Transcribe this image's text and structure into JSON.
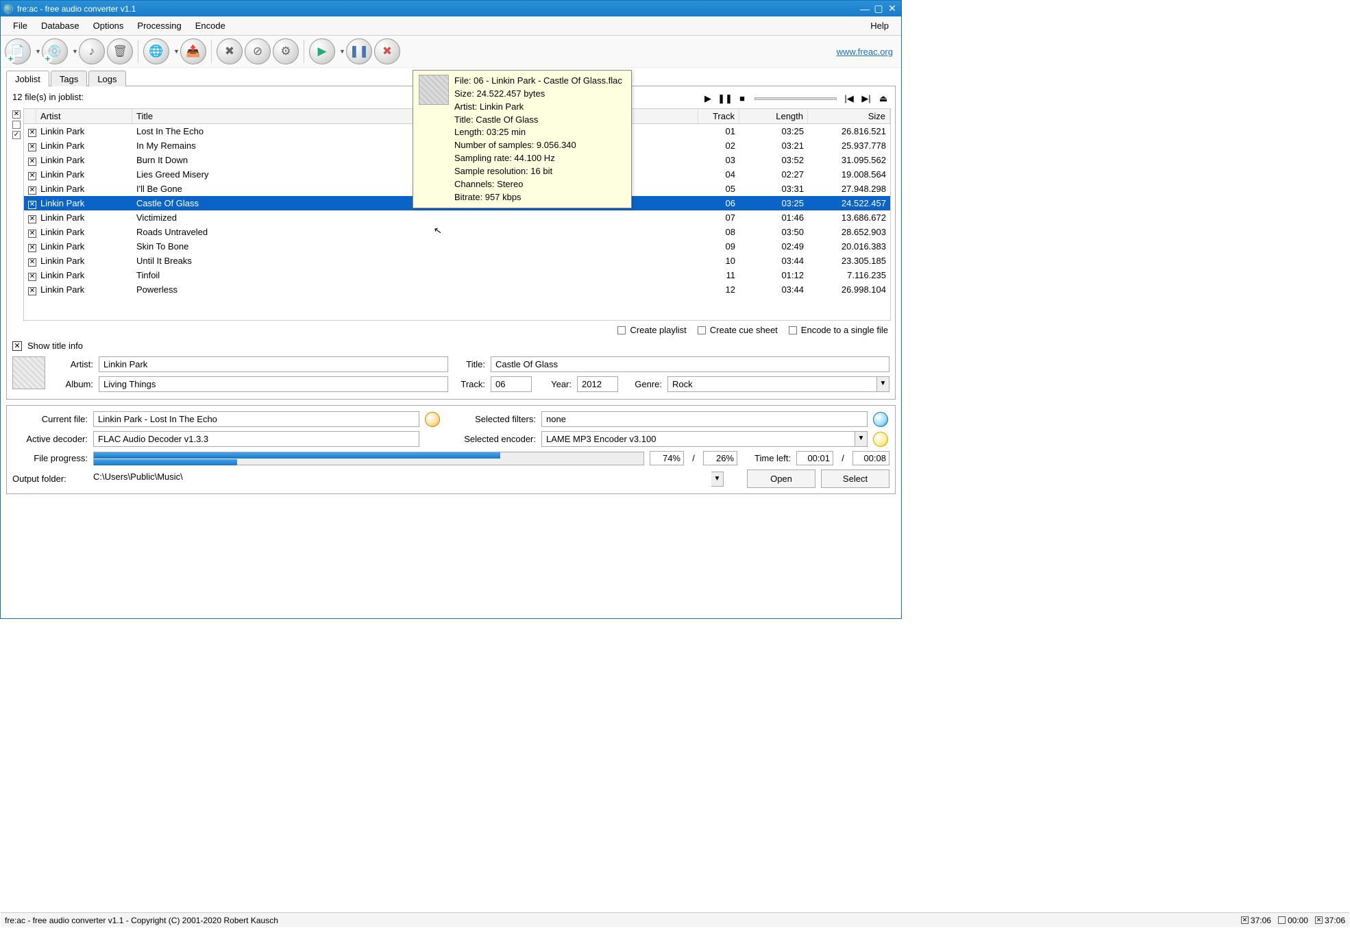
{
  "window": {
    "title": "fre:ac - free audio converter v1.1"
  },
  "menubar": {
    "file": "File",
    "database": "Database",
    "options": "Options",
    "processing": "Processing",
    "encode": "Encode",
    "help": "Help"
  },
  "toolbar": {
    "website": "www.freac.org"
  },
  "tabs": {
    "joblist": "Joblist",
    "tags": "Tags",
    "logs": "Logs"
  },
  "joblist": {
    "count_label": "12 file(s) in joblist:",
    "headers": {
      "artist": "Artist",
      "title": "Title",
      "track": "Track",
      "length": "Length",
      "size": "Size"
    },
    "rows": [
      {
        "artist": "Linkin Park",
        "title": "Lost In The Echo",
        "track": "01",
        "length": "03:25",
        "size": "26.816.521"
      },
      {
        "artist": "Linkin Park",
        "title": "In My Remains",
        "track": "02",
        "length": "03:21",
        "size": "25.937.778"
      },
      {
        "artist": "Linkin Park",
        "title": "Burn It Down",
        "track": "03",
        "length": "03:52",
        "size": "31.095.562"
      },
      {
        "artist": "Linkin Park",
        "title": "Lies Greed Misery",
        "track": "04",
        "length": "02:27",
        "size": "19.008.564"
      },
      {
        "artist": "Linkin Park",
        "title": "I'll Be Gone",
        "track": "05",
        "length": "03:31",
        "size": "27.948.298"
      },
      {
        "artist": "Linkin Park",
        "title": "Castle Of Glass",
        "track": "06",
        "length": "03:25",
        "size": "24.522.457"
      },
      {
        "artist": "Linkin Park",
        "title": "Victimized",
        "track": "07",
        "length": "01:46",
        "size": "13.686.672"
      },
      {
        "artist": "Linkin Park",
        "title": "Roads Untraveled",
        "track": "08",
        "length": "03:50",
        "size": "28.652.903"
      },
      {
        "artist": "Linkin Park",
        "title": "Skin To Bone",
        "track": "09",
        "length": "02:49",
        "size": "20.016.383"
      },
      {
        "artist": "Linkin Park",
        "title": "Until It Breaks",
        "track": "10",
        "length": "03:44",
        "size": "23.305.185"
      },
      {
        "artist": "Linkin Park",
        "title": "Tinfoil",
        "track": "11",
        "length": "01:12",
        "size": "7.116.235"
      },
      {
        "artist": "Linkin Park",
        "title": "Powerless",
        "track": "12",
        "length": "03:44",
        "size": "26.998.104"
      }
    ],
    "selected_index": 5,
    "options": {
      "playlist": "Create playlist",
      "cuesheet": "Create cue sheet",
      "single": "Encode to a single file"
    },
    "show_title": "Show title info"
  },
  "tooltip": {
    "file": "File: 06 - Linkin Park - Castle Of Glass.flac",
    "size": "Size: 24.522.457 bytes",
    "artist": "Artist: Linkin Park",
    "title": "Title: Castle Of Glass",
    "length": "Length: 03:25 min",
    "samples": "Number of samples: 9.056.340",
    "rate": "Sampling rate: 44.100 Hz",
    "res": "Sample resolution: 16 bit",
    "chan": "Channels: Stereo",
    "bitrate": "Bitrate: 957 kbps"
  },
  "meta": {
    "artist_lbl": "Artist:",
    "artist": "Linkin Park",
    "title_lbl": "Title:",
    "title": "Castle Of Glass",
    "album_lbl": "Album:",
    "album": "Living Things",
    "track_lbl": "Track:",
    "track": "06",
    "year_lbl": "Year:",
    "year": "2012",
    "genre_lbl": "Genre:",
    "genre": "Rock"
  },
  "status": {
    "curfile_lbl": "Current file:",
    "curfile": "Linkin Park - Lost In The Echo",
    "decoder_lbl": "Active decoder:",
    "decoder": "FLAC Audio Decoder v1.3.3",
    "filters_lbl": "Selected filters:",
    "filters": "none",
    "encoder_lbl": "Selected encoder:",
    "encoder": "LAME MP3 Encoder v3.100",
    "progress_lbl": "File progress:",
    "pct1": "74%",
    "slash": "/",
    "pct2": "26%",
    "timeleft_lbl": "Time left:",
    "time1": "00:01",
    "time2": "00:08",
    "folder_lbl": "Output folder:",
    "folder": "C:\\Users\\Public\\Music\\",
    "open": "Open",
    "select": "Select",
    "progress_top_pct": 74,
    "progress_bottom_pct": 26
  },
  "footer": {
    "text": "fre:ac - free audio converter v1.1 - Copyright (C) 2001-2020 Robert Kausch",
    "t1": "37:06",
    "t2": "00:00",
    "t3": "37:06"
  }
}
